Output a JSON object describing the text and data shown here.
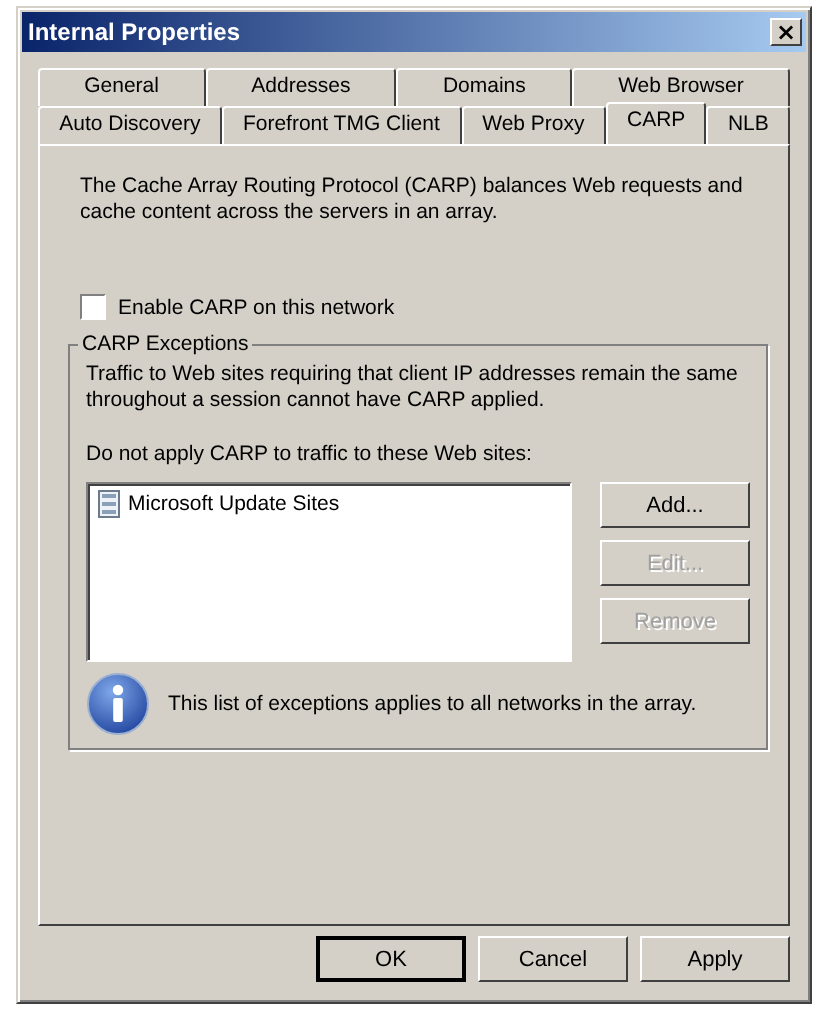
{
  "window": {
    "title": "Internal Properties",
    "close": "×"
  },
  "tab_rows": [
    [
      {
        "label": "General",
        "selected": false
      },
      {
        "label": "Addresses",
        "selected": false
      },
      {
        "label": "Domains",
        "selected": false
      },
      {
        "label": "Web Browser",
        "selected": false
      }
    ],
    [
      {
        "label": "Auto Discovery",
        "selected": false
      },
      {
        "label": "Forefront TMG Client",
        "selected": false
      },
      {
        "label": "Web Proxy",
        "selected": false
      },
      {
        "label": "CARP",
        "selected": true
      },
      {
        "label": "NLB",
        "selected": false
      }
    ]
  ],
  "description": "The Cache Array Routing Protocol (CARP) balances Web requests and cache content across the servers in an array.",
  "enable_checkbox": {
    "label": "Enable CARP on this network",
    "checked": false
  },
  "exceptions": {
    "title": "CARP Exceptions",
    "text": "Traffic to Web sites requiring that client IP addresses remain the same throughout a session cannot have CARP applied.",
    "list_label": "Do not apply CARP to traffic to these Web sites:",
    "items": [
      {
        "label": "Microsoft Update Sites",
        "selected": false
      }
    ],
    "buttons": [
      {
        "label": "Add...",
        "disabled": false
      },
      {
        "label": "Edit...",
        "disabled": true
      },
      {
        "label": "Remove",
        "disabled": true
      }
    ],
    "note": "This list of exceptions applies to all networks in the array."
  },
  "buttons": [
    {
      "label": "OK",
      "default": true
    },
    {
      "label": "Cancel",
      "default": false
    },
    {
      "label": "Apply",
      "default": false
    }
  ]
}
